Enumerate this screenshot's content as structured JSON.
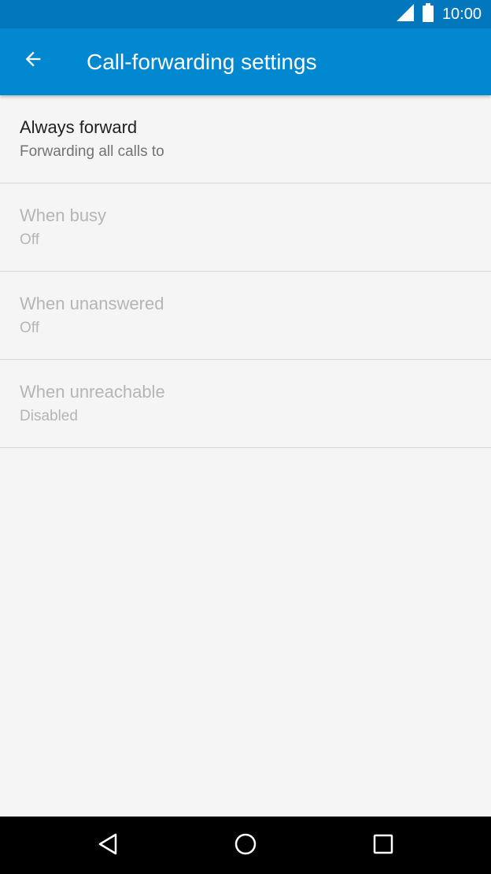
{
  "status_bar": {
    "time": "10:00",
    "icons": [
      "signal-icon",
      "battery-icon"
    ],
    "background": "#0277bd"
  },
  "app_bar": {
    "title": "Call-forwarding settings",
    "back_icon": "arrow-back-icon",
    "background": "#0288d1"
  },
  "settings": [
    {
      "title": "Always forward",
      "summary": "Forwarding all calls to",
      "enabled": true
    },
    {
      "title": "When busy",
      "summary": "Off",
      "enabled": false
    },
    {
      "title": "When unanswered",
      "summary": "Off",
      "enabled": false
    },
    {
      "title": "When unreachable",
      "summary": "Disabled",
      "enabled": false
    }
  ],
  "nav_bar": {
    "buttons": [
      "back-triangle-icon",
      "home-circle-icon",
      "recents-square-icon"
    ]
  }
}
